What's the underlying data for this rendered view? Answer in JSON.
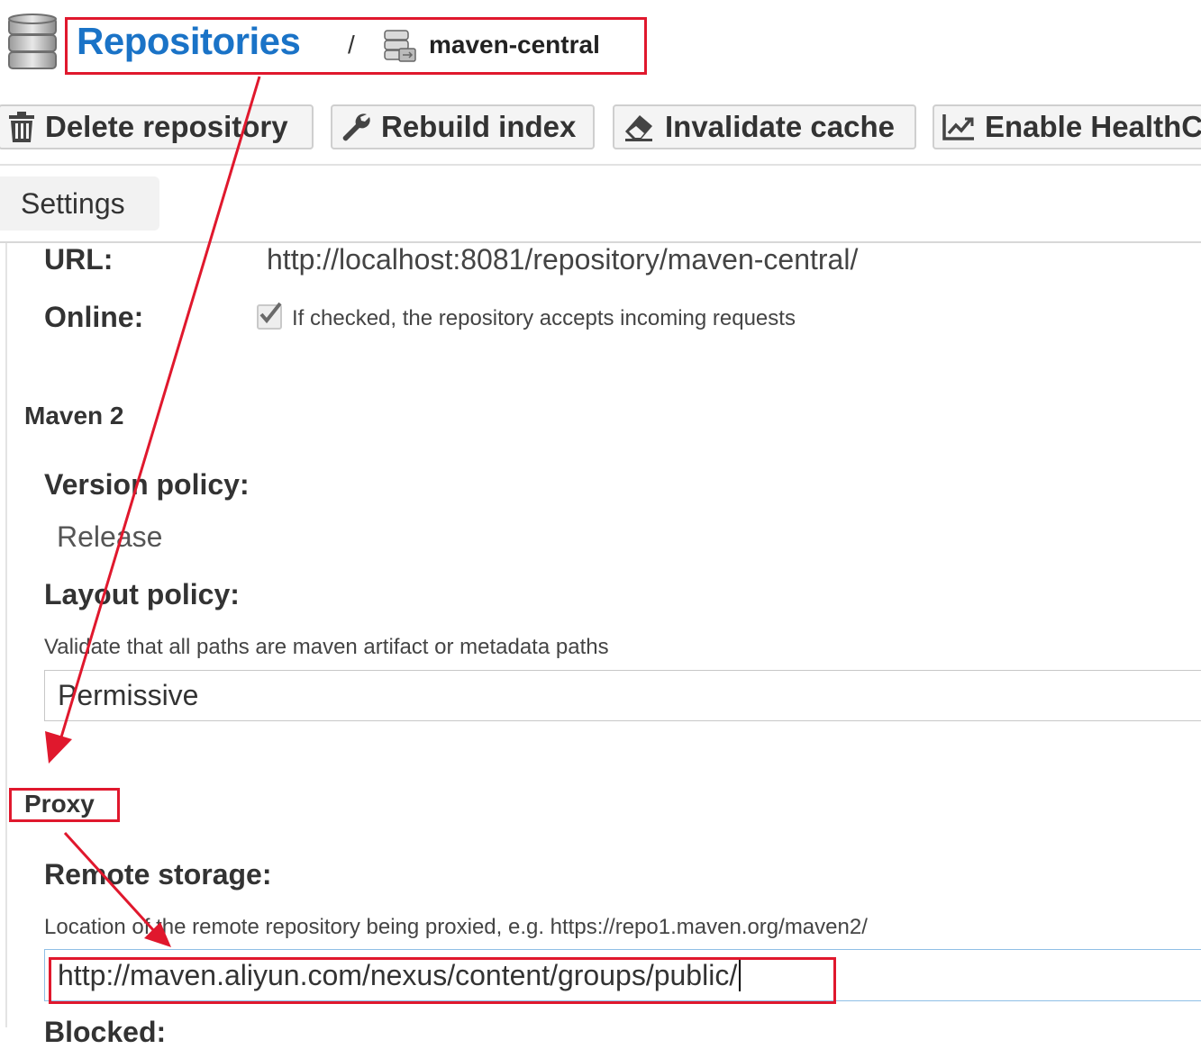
{
  "breadcrumb": {
    "root": "Repositories",
    "separator": "/",
    "current": "maven-central"
  },
  "toolbar": {
    "delete_label": "Delete repository",
    "rebuild_label": "Rebuild index",
    "invalidate_label": "Invalidate cache",
    "healthcheck_label": "Enable HealthC"
  },
  "tabs": [
    {
      "label": "Settings",
      "active": true
    }
  ],
  "settings": {
    "url_label": "URL:",
    "url_value": "http://localhost:8081/repository/maven-central/",
    "online_label": "Online:",
    "online_checked": true,
    "online_help": "If checked, the repository accepts incoming requests"
  },
  "maven2": {
    "section_title": "Maven 2",
    "version_policy_label": "Version policy:",
    "version_policy_value": "Release",
    "layout_policy_label": "Layout policy:",
    "layout_policy_help": "Validate that all paths are maven artifact or metadata paths",
    "layout_policy_value": "Permissive"
  },
  "proxy": {
    "section_title": "Proxy",
    "remote_storage_label": "Remote storage:",
    "remote_storage_help": "Location of the remote repository being proxied, e.g. https://repo1.maven.org/maven2/",
    "remote_storage_value": "http://maven.aliyun.com/nexus/content/groups/public/",
    "next_label_partial": "Blocked:"
  },
  "colors": {
    "link_blue": "#1a73c7",
    "annotation_red": "#e0182d",
    "focus_border": "#8fbfe6"
  },
  "icons": [
    "database-icon",
    "proxy-repository-icon",
    "trash-icon",
    "wrench-icon",
    "eraser-icon",
    "chart-line-icon",
    "checkmark-icon"
  ]
}
